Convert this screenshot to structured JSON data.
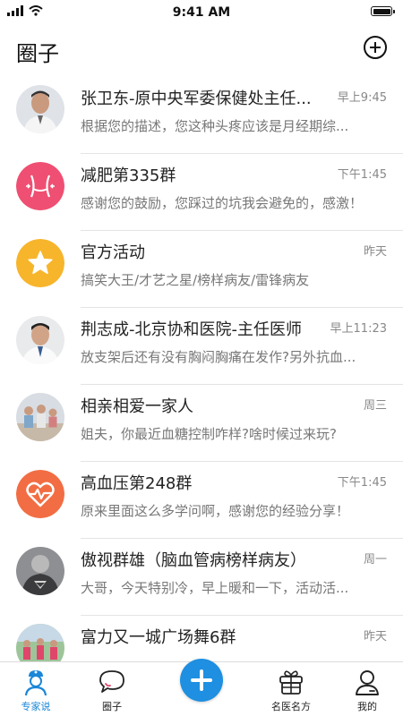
{
  "status_bar": {
    "time": "9:41 AM",
    "battery_level": 1.0
  },
  "header": {
    "title": "圈子",
    "add_icon": "plus-circle-icon"
  },
  "chats": [
    {
      "name": "张卫东-原中央军委保健处主任...",
      "time": "早上9:45",
      "message": "根据您的描述，您这种头疼应该是月经期综...",
      "avatar": "doctor-photo"
    },
    {
      "name": "减肥第335群",
      "time": "下午1:45",
      "message": "感谢您的鼓励，您踩过的坑我会避免的，感激！",
      "avatar": "waist-icon",
      "color": "#ef4f72"
    },
    {
      "name": "官方活动",
      "time": "昨天",
      "message": "搞笑大王/才艺之星/榜样病友/雷锋病友",
      "avatar": "star-icon",
      "color": "#f7b52c"
    },
    {
      "name": "荆志成-北京协和医院-主任医师",
      "time": "早上11:23",
      "message": "放支架后还有没有胸闷胸痛在发作?另外抗血...",
      "avatar": "doctor-photo"
    },
    {
      "name": "相亲相爱一家人",
      "time": "周三",
      "message": "姐夫，你最近血糖控制咋样?啥时候过来玩?",
      "avatar": "family-photo"
    },
    {
      "name": "高血压第248群",
      "time": "下午1:45",
      "message": "原来里面这么多学问啊，感谢您的经验分享！",
      "avatar": "heartbeat-icon",
      "color": "#f26d43"
    },
    {
      "name": "傲视群雄（脑血管病榜样病友）",
      "time": "周一",
      "message": "大哥，今天特别冷，早上暖和一下，活动活...",
      "avatar": "superman-photo"
    },
    {
      "name": "富力又一城广场舞6群",
      "time": "昨天",
      "message": "",
      "avatar": "dance-group-photo"
    }
  ],
  "tabs": [
    {
      "label": "专家说",
      "icon": "nurse-icon",
      "active": true
    },
    {
      "label": "圈子",
      "icon": "chat-bubble-icon",
      "active": false
    },
    {
      "label": "",
      "icon": "plus-icon",
      "active": false
    },
    {
      "label": "名医名方",
      "icon": "gift-box-icon",
      "active": false
    },
    {
      "label": "我的",
      "icon": "user-icon",
      "active": false
    }
  ],
  "colors": {
    "accent": "#1e8fe1",
    "tab_active": "#1a86d8"
  }
}
